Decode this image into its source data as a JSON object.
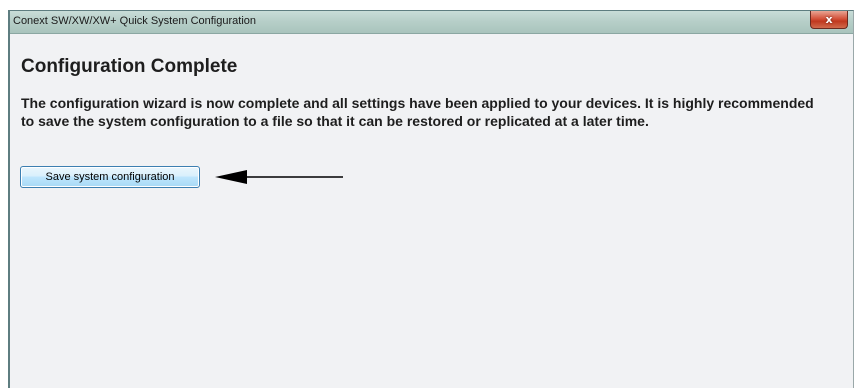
{
  "window": {
    "title": "Conext SW/XW/XW+ Quick System Configuration",
    "close_glyph": "x"
  },
  "main": {
    "heading": "Configuration Complete",
    "description": "The configuration wizard is now complete and all settings have been applied to your devices. It is highly recommended to save the system configuration to a file so that it can be restored or replicated at a later time.",
    "save_button_label": "Save system configuration"
  },
  "annotation": {
    "arrow_icon": "left-arrow-icon",
    "arrow_color": "#000000"
  },
  "colors": {
    "title_bar": "#b7cfc9",
    "close_button": "#d4533b",
    "content_background": "#f1f2f4",
    "button_border": "#3c7fb1"
  }
}
